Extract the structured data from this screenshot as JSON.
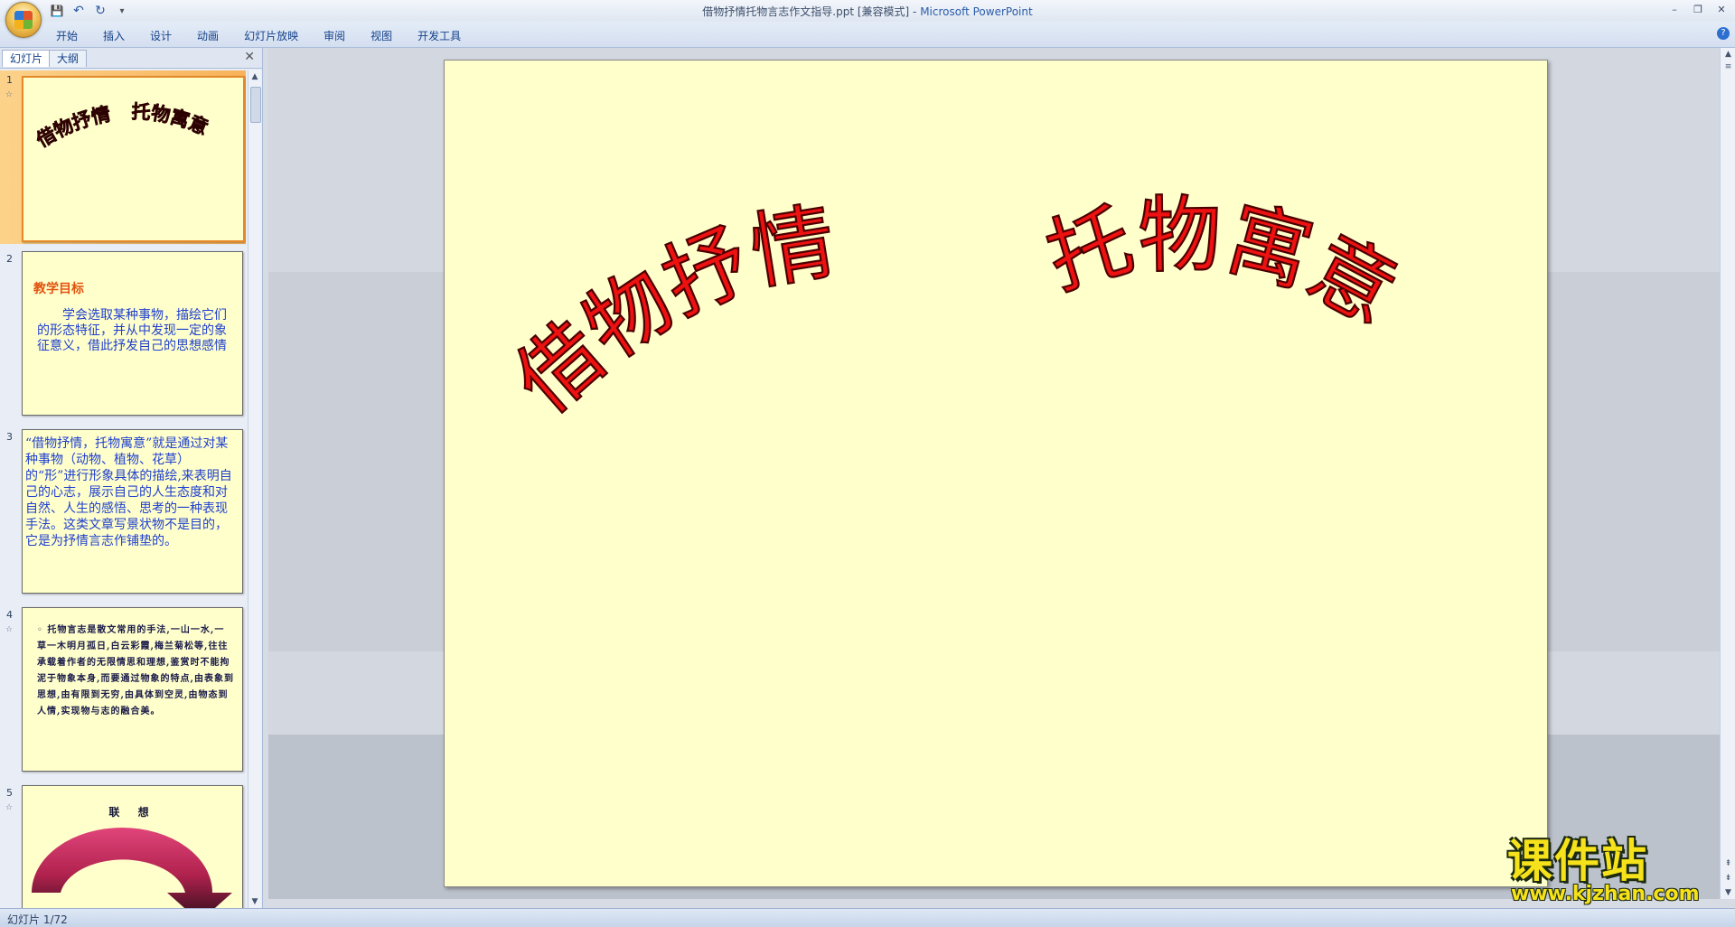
{
  "window": {
    "title": "借物抒情托物言志作文指导.ppt [兼容模式]",
    "title_sep": " - ",
    "app_name": "Microsoft PowerPoint",
    "min_glyph": "–",
    "restore_glyph": "❐",
    "close_glyph": "✕"
  },
  "qat": {
    "save_glyph": "💾",
    "undo_glyph": "↶",
    "redo_glyph": "↻",
    "more_glyph": "▾"
  },
  "ribbon": {
    "tabs": [
      "开始",
      "插入",
      "设计",
      "动画",
      "幻灯片放映",
      "审阅",
      "视图",
      "开发工具"
    ],
    "help_glyph": "?"
  },
  "pane": {
    "tabs": [
      "幻灯片",
      "大纲"
    ],
    "close_glyph": "✕",
    "thumbnails": [
      {
        "number": "1",
        "title_left": "借物抒情",
        "title_right": "托物寓意"
      },
      {
        "number": "2",
        "heading": "教学目标",
        "body": "学会选取某种事物，描绘它们的形态特征，并从中发现一定的象征意义，借此抒发自己的思想感情"
      },
      {
        "number": "3",
        "body": "“借物抒情，托物寓意”就是通过对某种事物（动物、植物、花草）的“形”进行形象具体的描绘,来表明自己的心志，展示自己的人生态度和对自然、人生的感悟、思考的一种表现手法。这类文章写景状物不是目的，它是为抒情言志作铺垫的。"
      },
      {
        "number": "4",
        "body": "◦ 托物言志是散文常用的手法,一山一水,一草一木明月孤日,白云彩霞,梅兰菊松等,往往承载着作者的无限情思和理想,鉴赏时不能拘泥于物象本身,而要通过物象的特点,由表象到思想,由有限到无穷,由具体到空灵,由物态到人情,实现物与志的融合美。"
      },
      {
        "number": "5",
        "heading": "联  想"
      }
    ],
    "star_glyph": "☆"
  },
  "slide": {
    "title_left": "借物抒情",
    "title_right": "托物寓意"
  },
  "status": {
    "text": "幻灯片 1/72"
  },
  "watermark": {
    "big": "课件站",
    "small": "www.kjzhan.com"
  },
  "colors": {
    "title_fill": "#ee1111",
    "thumb_title_fill": "#7a0f0f",
    "slide_bg": "#ffffcc"
  }
}
